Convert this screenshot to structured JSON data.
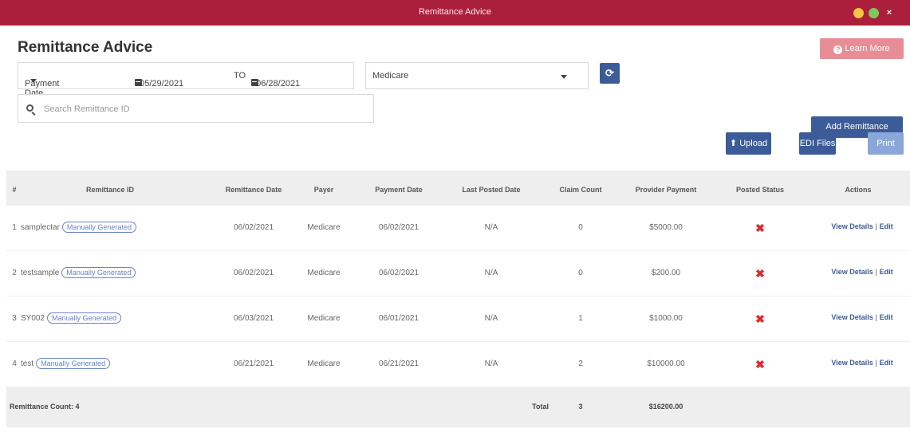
{
  "window": {
    "title": "Remittance Advice",
    "close_glyph": "×"
  },
  "page": {
    "title": "Remittance Advice",
    "learn_more": "Learn More",
    "learn_icon": "?"
  },
  "filters": {
    "date_type": "Payment Date",
    "from_date": "05/29/2021",
    "to_label": "TO",
    "to_date": "06/28/2021",
    "payer": "Medicare",
    "refresh_glyph": "⟳"
  },
  "search": {
    "placeholder": "Search Remittance ID",
    "value": ""
  },
  "actions": {
    "add": "Add Remittance",
    "upload": "Upload",
    "upload_icon": "⬆",
    "edi": "EDI Files",
    "print": "Print"
  },
  "table": {
    "headers": [
      "#",
      "Remittance ID",
      "Remittance Date",
      "Payer",
      "Payment Date",
      "Last Posted Date",
      "Claim Count",
      "Provider Payment",
      "Posted Status",
      "Actions"
    ],
    "rows": [
      {
        "num": "1",
        "id": "samplectar",
        "tag": "Manually Generated",
        "remit_date": "06/02/2021",
        "payer": "Medicare",
        "pay_date": "06/02/2021",
        "last_posted": "N/A",
        "claims": "0",
        "payment": "$5000.00",
        "status": "✖",
        "view": "View Details",
        "sep": "|",
        "edit": "Edit"
      },
      {
        "num": "2",
        "id": "testsample",
        "tag": "Manually Generated",
        "remit_date": "06/02/2021",
        "payer": "Medicare",
        "pay_date": "06/02/2021",
        "last_posted": "N/A",
        "claims": "0",
        "payment": "$200.00",
        "status": "✖",
        "view": "View Details",
        "sep": "|",
        "edit": "Edit"
      },
      {
        "num": "3",
        "id": "SY002",
        "tag": "Manually Generated",
        "remit_date": "06/03/2021",
        "payer": "Medicare",
        "pay_date": "06/01/2021",
        "last_posted": "N/A",
        "claims": "1",
        "payment": "$1000.00",
        "status": "✖",
        "view": "View Details",
        "sep": "|",
        "edit": "Edit"
      },
      {
        "num": "4",
        "id": "test",
        "tag": "Manually Generated",
        "remit_date": "06/21/2021",
        "payer": "Medicare",
        "pay_date": "06/21/2021",
        "last_posted": "N/A",
        "claims": "2",
        "payment": "$10000.00",
        "status": "✖",
        "view": "View Details",
        "sep": "|",
        "edit": "Edit"
      }
    ],
    "footer": {
      "count_label": "Remittance Count: 4",
      "total_label": "Total",
      "total_claims": "3",
      "total_payment": "$16200.00"
    }
  },
  "colors": {
    "titlebar": "#ab1f3c",
    "primary": "#3c5c99",
    "learn": "#e88d96",
    "status_x": "#e02828"
  }
}
